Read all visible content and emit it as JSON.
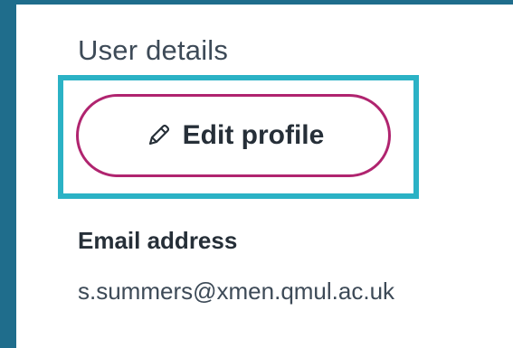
{
  "user_details": {
    "title": "User details",
    "edit_button": {
      "label": "Edit profile",
      "icon": "pencil-icon"
    },
    "fields": [
      {
        "label": "Email address",
        "value": "s.summers@xmen.qmul.ac.uk"
      }
    ]
  },
  "colors": {
    "page_background": "#ffffff",
    "side_strip": "#1f6d8c",
    "focus_outline": "#2bb2c5",
    "button_border": "#b0246f",
    "text_dark": "#262f38",
    "text_muted": "#3d4a57"
  }
}
